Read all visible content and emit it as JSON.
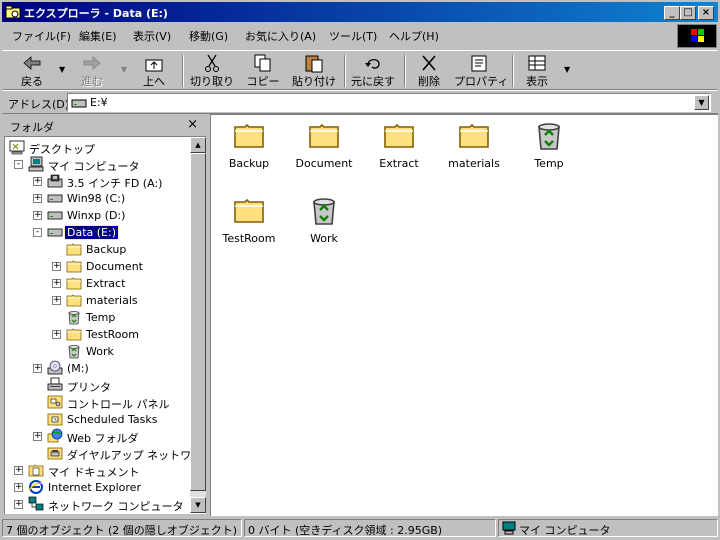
{
  "window": {
    "title": "エクスプローラ - Data (E:)",
    "controls": {
      "minimize": "_",
      "maximize": "□",
      "close": "×"
    }
  },
  "menu": [
    "ファイル(F)",
    "編集(E)",
    "表示(V)",
    "移動(G)",
    "お気に入り(A)",
    "ツール(T)",
    "ヘルプ(H)"
  ],
  "toolbar": {
    "back": "戻る",
    "forward": "進む",
    "up": "上へ",
    "cut": "切り取り",
    "copy": "コピー",
    "paste": "貼り付け",
    "undo": "元に戻す",
    "delete": "削除",
    "properties": "プロパティ",
    "view": "表示"
  },
  "address": {
    "label": "アドレス(D)",
    "value": "E:¥"
  },
  "folder_pane": {
    "title": "フォルダ",
    "close": "×",
    "tree": [
      {
        "label": "デスクトップ",
        "icon": "desktop-icon"
      },
      {
        "label": "マイ コンピュータ",
        "icon": "computer-icon"
      },
      {
        "label": "3.5 インチ FD (A:)",
        "icon": "floppy-icon"
      },
      {
        "label": "Win98 (C:)",
        "icon": "drive-icon"
      },
      {
        "label": "Winxp (D:)",
        "icon": "drive-icon"
      },
      {
        "label": "Data (E:)",
        "icon": "drive-icon"
      },
      {
        "label": "Backup",
        "icon": "folder-icon"
      },
      {
        "label": "Document",
        "icon": "folder-icon"
      },
      {
        "label": "Extract",
        "icon": "folder-icon"
      },
      {
        "label": "materials",
        "icon": "folder-icon"
      },
      {
        "label": "Temp",
        "icon": "recycle-icon"
      },
      {
        "label": "TestRoom",
        "icon": "folder-icon"
      },
      {
        "label": "Work",
        "icon": "recycle-icon"
      },
      {
        "label": "(M:)",
        "icon": "cdrom-icon"
      },
      {
        "label": "プリンタ",
        "icon": "printer-icon"
      },
      {
        "label": "コントロール パネル",
        "icon": "control-panel-icon"
      },
      {
        "label": "Scheduled Tasks",
        "icon": "tasks-icon"
      },
      {
        "label": "Web フォルダ",
        "icon": "web-folder-icon"
      },
      {
        "label": "ダイヤルアップ ネットワーク",
        "icon": "dialup-icon"
      },
      {
        "label": "マイ ドキュメント",
        "icon": "my-documents-icon"
      },
      {
        "label": "Internet Explorer",
        "icon": "ie-icon"
      },
      {
        "label": "ネットワーク コンピュータ",
        "icon": "network-icon"
      }
    ]
  },
  "content_items": [
    {
      "label": "Backup",
      "icon": "folder-icon"
    },
    {
      "label": "Document",
      "icon": "folder-icon"
    },
    {
      "label": "Extract",
      "icon": "folder-icon"
    },
    {
      "label": "materials",
      "icon": "folder-icon"
    },
    {
      "label": "Temp",
      "icon": "recycle-icon"
    },
    {
      "label": "TestRoom",
      "icon": "folder-icon"
    },
    {
      "label": "Work",
      "icon": "recycle-icon"
    }
  ],
  "status": {
    "objects": "7 個のオブジェクト (2 個の隠しオブジェクト)",
    "size": "0 バイト (空きディスク領域 : 2.95GB)",
    "zone": "マイ コンピュータ"
  },
  "colors": {
    "titlebar": "#000080",
    "face": "#c0c0c0",
    "selection": "#000080"
  }
}
